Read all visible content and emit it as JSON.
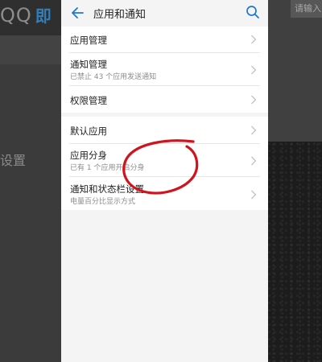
{
  "background": {
    "left_app_label": "QQ",
    "left_app_label_2": "即",
    "left_partial_text": "设置",
    "right_chip_text": "请输入"
  },
  "header": {
    "title": "应用和通知",
    "back_icon": "arrow-left-icon",
    "search_icon": "search-icon",
    "accent_color": "#1a78d6"
  },
  "groups": [
    {
      "items": [
        {
          "title": "应用管理",
          "subtitle": ""
        },
        {
          "title": "通知管理",
          "subtitle": "已禁止 43 个应用发送通知"
        },
        {
          "title": "权限管理",
          "subtitle": ""
        }
      ]
    },
    {
      "items": [
        {
          "title": "默认应用",
          "subtitle": ""
        },
        {
          "title": "应用分身",
          "subtitle": "已有 1 个应用开启分身"
        },
        {
          "title": "通知和状态栏设置",
          "subtitle": "电量百分比显示方式"
        }
      ]
    }
  ],
  "annotation": {
    "shape": "hand-drawn circle",
    "color": "#d0141e",
    "target": "应用分身"
  },
  "colors": {
    "panel_bg": "#f4f4f4",
    "card_bg": "#ffffff",
    "title_text": "#222222",
    "subtitle_text": "#8c8c8c",
    "chevron": "#c2c2c2"
  }
}
